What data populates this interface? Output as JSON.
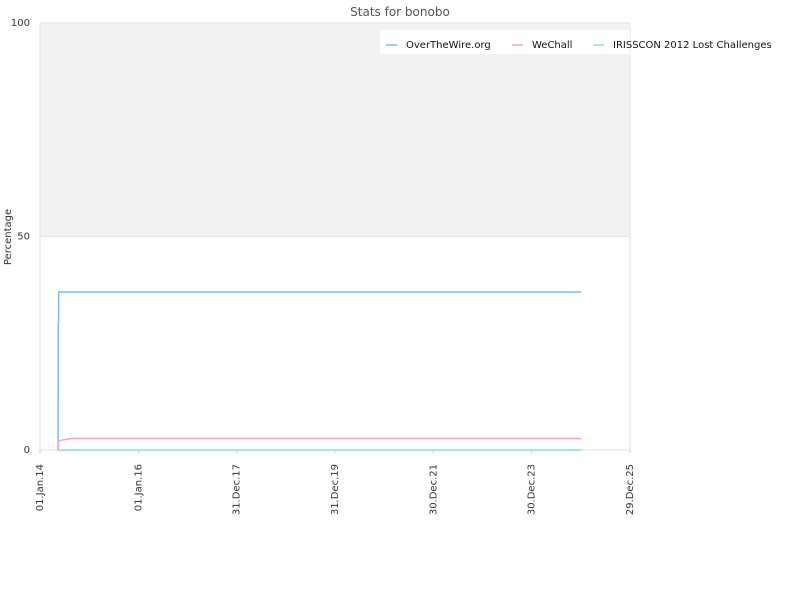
{
  "chart_data": {
    "type": "line",
    "title": "Stats for bonobo",
    "xlabel": "",
    "ylabel": "Percentage",
    "xlim": [
      "2014-01-01",
      "2025-12-29"
    ],
    "ylim": [
      0,
      100
    ],
    "x_ticks": [
      "01.Jan.14",
      "01.Jan.16",
      "31.Dec.17",
      "31.Dec.19",
      "30.Dec.21",
      "30.Dec.23",
      "29.Dec.25"
    ],
    "y_ticks": [
      0,
      50,
      100
    ],
    "grid": true,
    "legend_position": "top-right",
    "series": [
      {
        "name": "OverTheWire.org",
        "color": "#7fb8e8",
        "x": [
          "2014-05-15",
          "2014-05-15",
          "2014-05-17",
          "2014-05-17",
          "2014-05-19",
          "2014-05-20",
          "2024-12-31"
        ],
        "y": [
          0,
          13.2,
          13.2,
          30,
          30,
          37,
          37
        ]
      },
      {
        "name": "WeChall",
        "color": "#f4a0c8",
        "x": [
          "2014-05-15",
          "2014-05-16",
          "2014-06-10",
          "2014-07-15",
          "2014-08-20",
          "2024-12-31"
        ],
        "y": [
          0,
          2,
          2.3,
          2.5,
          2.7,
          2.7
        ]
      },
      {
        "name": "IRISSCON 2012 Lost Challenges",
        "color": "#90e0c8",
        "x": [
          "2014-05-15",
          "2024-12-31"
        ],
        "y": [
          0,
          0
        ]
      }
    ]
  }
}
